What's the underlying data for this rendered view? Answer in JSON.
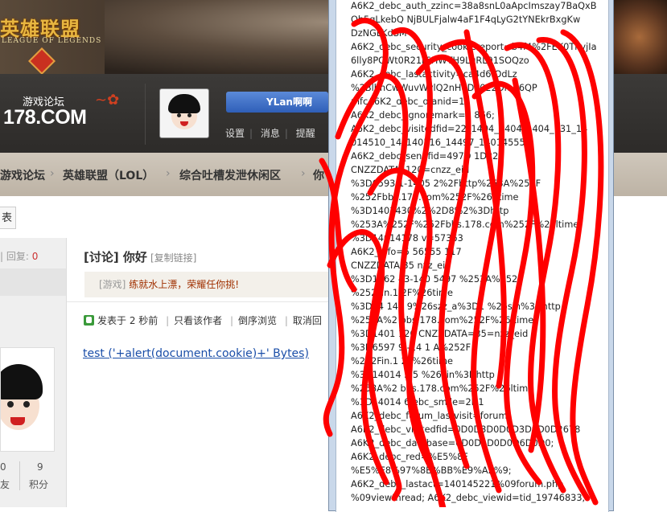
{
  "banner": {
    "logo_cn": "英雄联盟",
    "logo_en": "LEAGUE OF LEGENDS"
  },
  "site": {
    "logo_cn": "游戏论坛",
    "logo_en": "178.COM"
  },
  "user": {
    "name": "YLan啊啊",
    "links": [
      "设置",
      "消息",
      "提醒"
    ]
  },
  "breadcrumb": [
    "游戏论坛",
    "英雄联盟（LOL）",
    "综合吐槽发泄休闲区",
    "你"
  ],
  "post_button": "表",
  "thread_stats": {
    "views_label": "|",
    "reply_label": "回复:",
    "reply_count": "0"
  },
  "post": {
    "title": "[讨论] 你好",
    "copy_link": "[复制链接]",
    "notice_tag": "[游戏]",
    "notice_msg": "练就水上漂，荣耀任你挑!",
    "meta": {
      "posted": "发表于 2 秒前",
      "only_author": "只看该作者",
      "reverse": "倒序浏览",
      "cancel": "取消回"
    },
    "body": "test ('+alert(document.cookie)+' Bytes)"
  },
  "author_stats": [
    {
      "value": "0",
      "label": "友"
    },
    {
      "value": "9",
      "label": "积分"
    }
  ],
  "cookie_dump": "A6K2_debc_auth_zzinc=38a8snL0aApcImszay7BaQxB\nQh5qLkebQ NjBULFjalw4aF1F4qLyG2tYNEkrBxgKw\nDzNGLKdSM\nA6K2_debc_security_cookiereport=b4f4%2FEK0TnyjIa\n6lly8POWt0R21r6HWTH9LuRL91SOQzo\nA6K2_debc_lastactivity=ca4d6fOdLz\n%2BlbnCwWuvWylQ2nHdDo022Omd6QP\nmfcA6K2_debc_ofanid=1\nA6K2_debc_ignoremark=1 866;\nA6K2_debc_visitedfid=22_1404_1404_1404_731_14\n014510_14_140516_14497_140145553;\nA6K2_debc_sendfid=497D 1D22;\nCNZZDATA4120=cnzz_eid\n%3D6593 1-1405 2%2Fhttp%253A%252F\n%252Fbbs.178.com%252F%26ntime\n%3D1401430%2%2D8%2%3Dhttp\n%253A%252F%252Fbbs.178.com%252F%26ltime\n%3D14014178 v=57363\nA6K2_info=5 56555 117\nCNZZDATA 35 nzz_eid\n%3D1362 43-140 5497 %253A%252F\n%252Fin.1 2F%26time\n%3D14 143 9%26szz_a%3D1 %26sin%3Dhttp\n%253A%2 bbs.178.com%252F%26ltime\n%3D1401 126 CNZZDATA=35=nzz_eid\n%3D6597 9 -14 1 A%252F\n%252Fin.1 2F%26time\n%3D14014 3 5 %26sin%3Dhttp\n%253A%2 bbs.178.com%252F%26ltime\n%3D14014 6 ebc_smile=2D1\nA6K2_debc_forum_lastvisit=forum\nA6K2_debc_visitedfid=0D0D3D0D0D3D0D0D2678\nA6K2_debc_database=0D0D1D0D0D6D0D0;\nA6K2_debc_red=%E5%8F\n%E5%E8%97%8B%BB%E9%A2%9;\nA6K2_debc_lastact=140145221%09forum.php\n%09viewthread; A6K2_debc_viewid=tid_19746833;"
}
